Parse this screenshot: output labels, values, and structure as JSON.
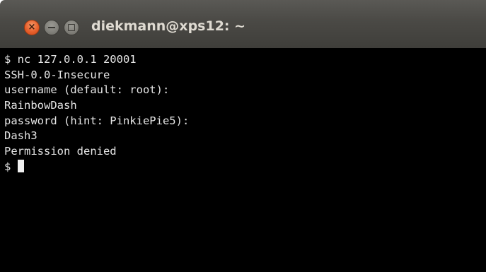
{
  "window": {
    "title": "diekmann@xps12: ~",
    "buttons": {
      "close_icon": "close-x",
      "minimize_icon": "minimize-bar",
      "maximize_icon": "maximize-box"
    }
  },
  "terminal": {
    "lines": [
      "$ nc 127.0.0.1 20001",
      "SSH-0.0-Insecure",
      "username (default: root):",
      "RainbowDash",
      "password (hint: PinkiePie5):",
      "Dash3",
      "Permission denied"
    ],
    "prompt": "$ "
  },
  "colors": {
    "close_button": "#e8602c",
    "titlebar": "#4a4945",
    "terminal_bg": "#000000",
    "terminal_fg": "#e6e6e6"
  }
}
